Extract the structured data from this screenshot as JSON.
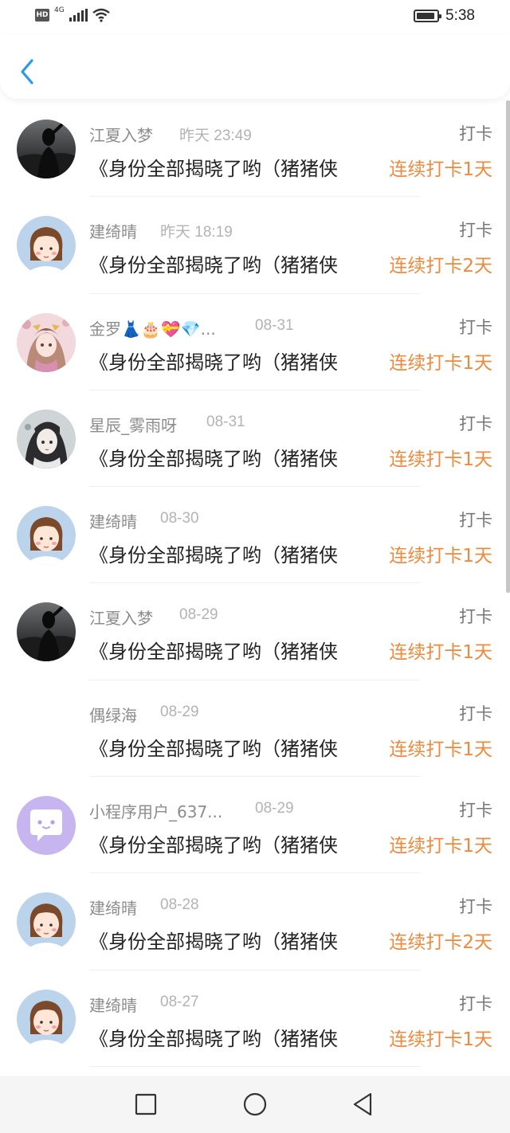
{
  "status_bar": {
    "hd": "HD",
    "network": "4G",
    "time": "5:38"
  },
  "header": {
    "back_icon": "chevron-left-icon",
    "accent_color": "#2b9ae6"
  },
  "list": {
    "items": [
      {
        "name": "江夏入梦",
        "time": "昨天 23:49",
        "type": "打卡",
        "title": "《身份全部揭晓了哟（猪猪侠",
        "streak": "连续打卡1天",
        "avatar": "dark-photo"
      },
      {
        "name": "建绮晴",
        "time": "昨天 18:19",
        "type": "打卡",
        "title": "《身份全部揭晓了哟（猪猪侠",
        "streak": "连续打卡2天",
        "avatar": "cartoon-girl"
      },
      {
        "name": "金罗👗🎂💝💎...",
        "time": "08-31",
        "type": "打卡",
        "title": "《身份全部揭晓了哟（猪猪侠",
        "streak": "连续打卡1天",
        "avatar": "anime-pink"
      },
      {
        "name": "星辰_雾雨呀",
        "time": "08-31",
        "type": "打卡",
        "title": "《身份全部揭晓了哟（猪猪侠",
        "streak": "连续打卡1天",
        "avatar": "anime-grey"
      },
      {
        "name": "建绮晴",
        "time": "08-30",
        "type": "打卡",
        "title": "《身份全部揭晓了哟（猪猪侠",
        "streak": "连续打卡1天",
        "avatar": "cartoon-girl"
      },
      {
        "name": "江夏入梦",
        "time": "08-29",
        "type": "打卡",
        "title": "《身份全部揭晓了哟（猪猪侠",
        "streak": "连续打卡1天",
        "avatar": "dark-photo"
      },
      {
        "name": "偶绿海",
        "time": "08-29",
        "type": "打卡",
        "title": "《身份全部揭晓了哟（猪猪侠",
        "streak": "连续打卡1天",
        "avatar": "none"
      },
      {
        "name": "小程序用户_637...",
        "time": "08-29",
        "type": "打卡",
        "title": "《身份全部揭晓了哟（猪猪侠",
        "streak": "连续打卡1天",
        "avatar": "chat-bubble"
      },
      {
        "name": "建绮晴",
        "time": "08-28",
        "type": "打卡",
        "title": "《身份全部揭晓了哟（猪猪侠",
        "streak": "连续打卡2天",
        "avatar": "cartoon-girl"
      },
      {
        "name": "建绮晴",
        "time": "08-27",
        "type": "打卡",
        "title": "《身份全部揭晓了哟（猪猪侠",
        "streak": "连续打卡1天",
        "avatar": "cartoon-girl"
      }
    ]
  },
  "nav_bar": {
    "icons": [
      "square-icon",
      "circle-home-icon",
      "triangle-back-icon"
    ]
  },
  "colors": {
    "streak": "#f0893c",
    "name": "#8c8c8c",
    "time": "#b3b3b3",
    "title": "#222222"
  }
}
